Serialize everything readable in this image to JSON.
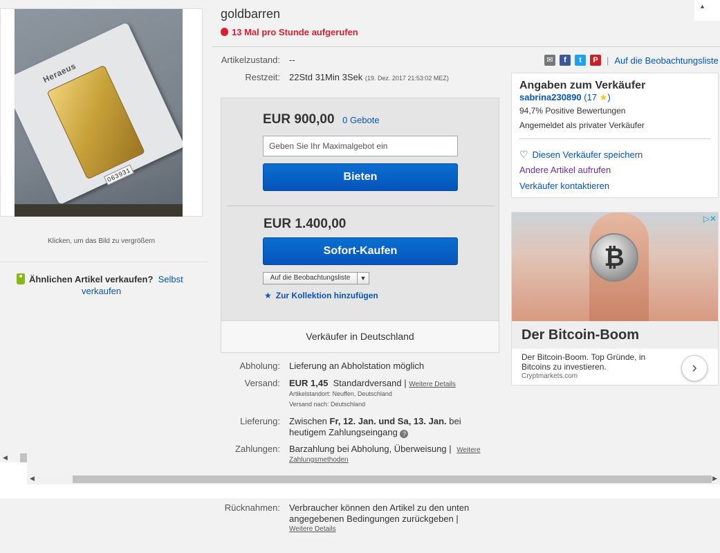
{
  "listing": {
    "title": "goldbarren",
    "views_text": "13 Mal pro Stunde aufgerufen",
    "image_hint": "Klicken, um das Bild zu vergrößern",
    "image_brand": "Heraeus",
    "image_serial": "063931"
  },
  "sell_similar": {
    "label": "Ähnlichen Artikel verkaufen?",
    "link_line1": "Selbst",
    "link_line2": "verkaufen"
  },
  "details": {
    "condition_label": "Artikelzustand:",
    "condition_value": "--",
    "time_label": "Restzeit:",
    "time_value": "22Std 31Min 3Sek",
    "time_end": "(19. Dez. 2017  21:53:02 MEZ)"
  },
  "share": {
    "watchlist_link": "Auf die Beobachtungsliste",
    "separator": "|"
  },
  "bid": {
    "price": "EUR 900,00",
    "bids_count": "0 Gebote",
    "input_placeholder": "Geben Sie Ihr Maximalgebot ein",
    "button": "Bieten"
  },
  "buy_now": {
    "price": "EUR 1.400,00",
    "button": "Sofort-Kaufen",
    "watch_dropdown": "Auf die Beobachtungsliste",
    "collection": "Zur Kollektion hinzufügen"
  },
  "seller_location": "Verkäufer in Deutschland",
  "shipping": {
    "pickup_label": "Abholung:",
    "pickup_value": "Lieferung an Abholstation möglich",
    "shipping_label": "Versand:",
    "shipping_price": "EUR 1,45",
    "shipping_method": "Standardversand |",
    "shipping_more": "Weitere Details",
    "item_location": "Artikelstandort:  Neuffen, Deutschland",
    "ships_to": "Versand nach:  Deutschland",
    "delivery_label": "Lieferung:",
    "delivery_prefix": "Zwischen",
    "delivery_dates": "Fr, 12. Jan. und Sa, 13. Jan.",
    "delivery_suffix": "bei",
    "delivery_line2": "heutigem Zahlungseingang",
    "payment_label": "Zahlungen:",
    "payment_value": "Barzahlung bei Abholung,  Überweisung  |",
    "payment_more1": "Weitere",
    "payment_more2": "Zahlungsmethoden",
    "returns_label": "Rücknahmen:",
    "returns_line1": "Verbraucher können den Artikel zu den unten",
    "returns_line2": "angegebenen Bedingungen zurückgeben |",
    "returns_more": "Weitere Details"
  },
  "seller": {
    "heading": "Angaben zum Verkäufer",
    "name": "sabrina230890",
    "feedback": "(17",
    "feedback_close": ")",
    "positive": "94,7% Positive Bewertungen",
    "account_type": "Angemeldet als privater Verkäufer",
    "save_seller": "Diesen Verkäufer speichern",
    "other_items": "Andere Artikel aufrufen",
    "contact": "Verkäufer kontaktieren"
  },
  "ad": {
    "headline": "Der Bitcoin-Boom",
    "copy": "Der Bitcoin-Boom. Top Gründe, in Bitcoins zu investieren.",
    "domain": "Cryptmarkets.com",
    "coin_symbol": "₿"
  },
  "icons": [
    "fire-icon",
    "tag-icon",
    "mail-icon",
    "facebook-icon",
    "twitter-icon",
    "pinterest-icon",
    "star-icon",
    "heart-icon",
    "help-icon",
    "chevron-right-icon",
    "adchoices-icon"
  ],
  "colors": {
    "link": "#0654ba",
    "alert": "#dd1e31",
    "button": "#0654ba",
    "star": "#f5c518"
  }
}
